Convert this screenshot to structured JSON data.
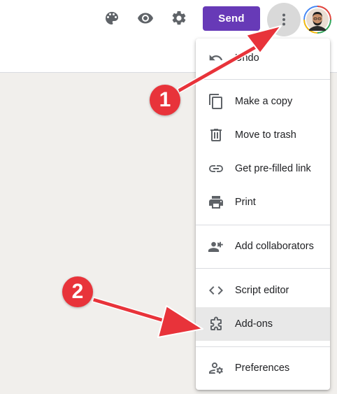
{
  "toolbar": {
    "icons": [
      "palette-icon",
      "eye-icon",
      "gear-icon",
      "more-vert-icon"
    ],
    "send_label": "Send",
    "send_color": "#673ab7"
  },
  "menu": {
    "items": [
      {
        "label": "Undo",
        "icon": "undo-icon"
      },
      {
        "label": "Make a copy",
        "icon": "copy-icon"
      },
      {
        "label": "Move to trash",
        "icon": "trash-icon"
      },
      {
        "label": "Get pre-filled link",
        "icon": "link-icon"
      },
      {
        "label": "Print",
        "icon": "print-icon"
      },
      {
        "label": "Add collaborators",
        "icon": "add-people-icon"
      },
      {
        "label": "Script editor",
        "icon": "code-icon"
      },
      {
        "label": "Add-ons",
        "icon": "puzzle-icon"
      },
      {
        "label": "Preferences",
        "icon": "person-settings-icon"
      }
    ],
    "highlighted": "Add-ons"
  },
  "annotations": {
    "step1": "1",
    "step2": "2",
    "color": "#e8333a"
  }
}
